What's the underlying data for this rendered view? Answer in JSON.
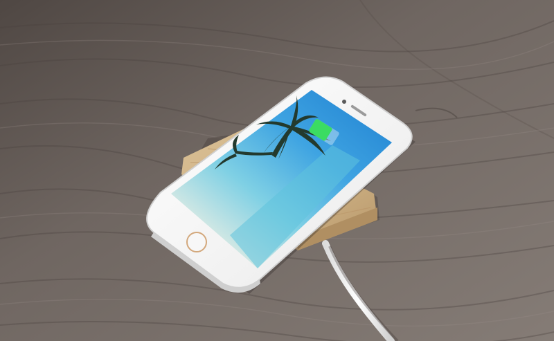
{
  "scene": {
    "subject": "smartphone-on-wireless-charging-pad",
    "colors": {
      "table_dark": "#5d5450",
      "table_mid": "#756c67",
      "table_light": "#8a817b",
      "pad_wood": "#d7bd92",
      "pad_wood_dark": "#b99a6c",
      "phone_body": "#f4f4f4",
      "phone_edge": "#d8d8d8",
      "screen_sky": "#3a96d8",
      "screen_sea": "#6ec8df",
      "screen_sand": "#e6ead8",
      "battery_fill": "#3bdc62",
      "cable": "#f6f6f6"
    },
    "icons": {
      "home_button": "home-button-icon",
      "battery": "battery-charging-icon",
      "camera": "front-camera-icon"
    },
    "battery_level": 0.7
  }
}
